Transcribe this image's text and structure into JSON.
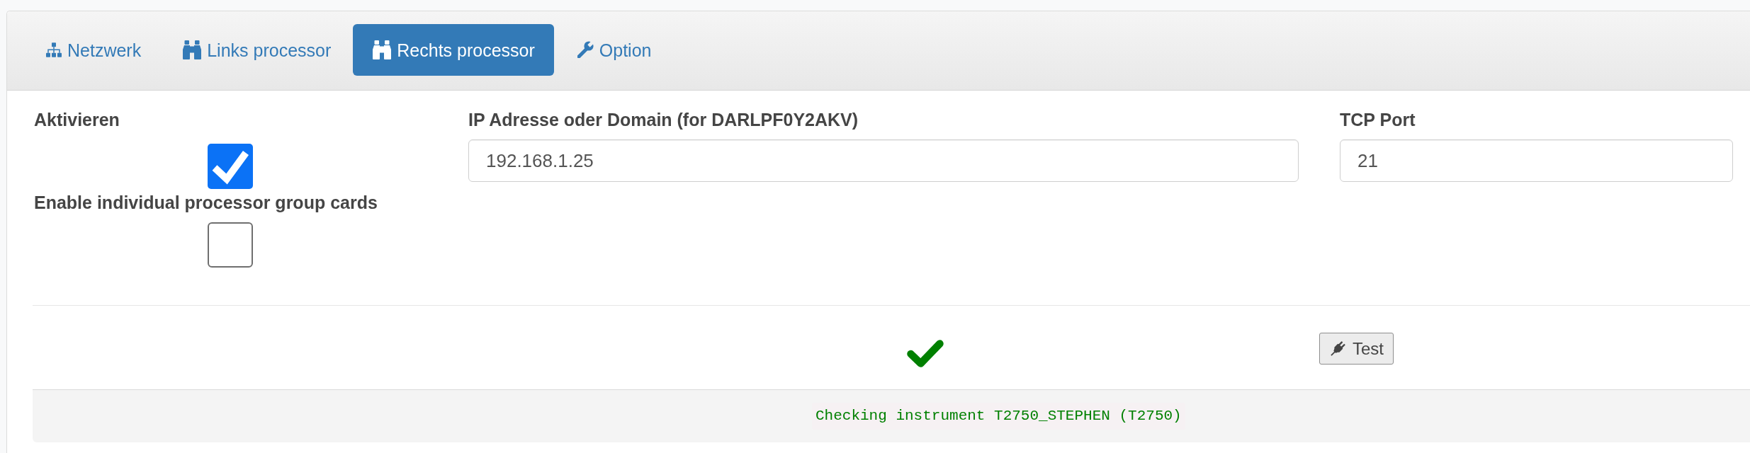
{
  "tabs": [
    {
      "label": "Netzwerk",
      "selected": false
    },
    {
      "label": "Links processor",
      "selected": false
    },
    {
      "label": "Rechts processor",
      "selected": true
    },
    {
      "label": "Option",
      "selected": false
    }
  ],
  "settings": {
    "activate": {
      "label": "Aktivieren",
      "checked": true
    },
    "group_cards": {
      "label": "Enable individual processor group cards",
      "checked": false
    },
    "ip_address": {
      "label": "IP Adresse oder Domain (for DARLPF0Y2AKV)",
      "value": "192.168.1.25"
    },
    "tcp_port": {
      "label": "TCP Port",
      "value": "21"
    }
  },
  "test": {
    "connection_ok": true,
    "button": "Test"
  },
  "log": {
    "message": "Checking instrument T2750_STEPHEN (T2750)"
  }
}
